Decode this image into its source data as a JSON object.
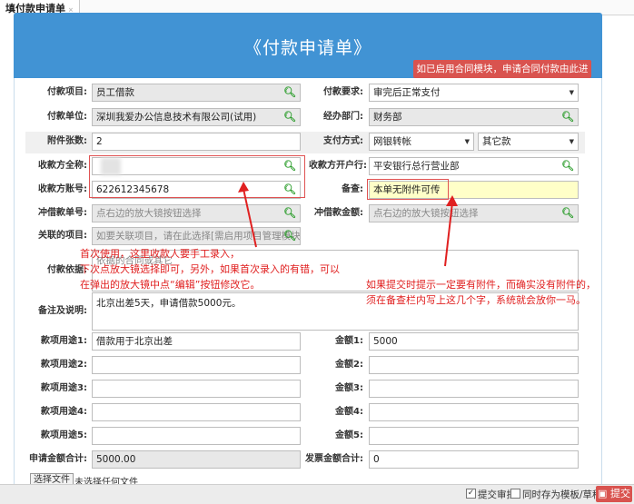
{
  "tab": {
    "label": "填付款申请单",
    "close": "×"
  },
  "form": {
    "title": "《付款申请单》",
    "contract_link": "如已启用合同模块，申请合同付款由此进>>",
    "pay_item": {
      "label": "付款项目:",
      "value": "员工借款"
    },
    "pay_req": {
      "label": "付款要求:",
      "value": "审完后正常支付"
    },
    "pay_unit": {
      "label": "付款单位:",
      "value": "深圳我爱办公信息技术有限公司(试用)"
    },
    "dept": {
      "label": "经办部门:",
      "value": "财务部"
    },
    "attach": {
      "label": "附件张数:",
      "value": "2"
    },
    "pay_method": {
      "label": "支付方式:",
      "value": "网银转帐",
      "value2": "其它款"
    },
    "payee_name": {
      "label": "收款方全称:",
      "value": ""
    },
    "payee_bank": {
      "label": "收款方开户行:",
      "value": "平安银行总行营业部"
    },
    "payee_acct": {
      "label": "收款方账号:",
      "value": "622612345678"
    },
    "remark": {
      "label": "备查:",
      "value": "本单无附件可传"
    },
    "offset_no": {
      "label": "冲借款单号:",
      "placeholder": "点右边的放大镜按钮选择"
    },
    "offset_amt": {
      "label": "冲借款金额:",
      "placeholder": "点右边的放大镜按钮选择"
    },
    "project": {
      "label": "关联的项目:",
      "placeholder": "如要关联项目，请在此选择[需启用项目管理模块]"
    },
    "basis": {
      "label": "付款依据:",
      "placeholder": "依据的合同或其它"
    },
    "desc": {
      "label": "备注及说明:",
      "value": "北京出差5天，申请借款5000元。"
    },
    "uses": [
      {
        "label": "款项用途1:",
        "value": "借款用于北京出差",
        "amt_label": "金额1:",
        "amt": "5000"
      },
      {
        "label": "款项用途2:",
        "value": "",
        "amt_label": "金额2:",
        "amt": ""
      },
      {
        "label": "款项用途3:",
        "value": "",
        "amt_label": "金额3:",
        "amt": ""
      },
      {
        "label": "款项用途4:",
        "value": "",
        "amt_label": "金额4:",
        "amt": ""
      },
      {
        "label": "款项用途5:",
        "value": "",
        "amt_label": "金额5:",
        "amt": ""
      }
    ],
    "total": {
      "label": "申请金额合计:",
      "value": "5000.00"
    },
    "invoice_total": {
      "label": "发票金额合计:",
      "value": "0"
    },
    "file": {
      "button": "选择文件",
      "status": "未选择任何文件"
    }
  },
  "notes": {
    "left": [
      "首次使用，这里收款人要手工录入，",
      "下次点放大镜选择即可，另外，如果首次录入的有错，可以",
      "在弹出的放大镜中点“编辑”按钮修改它。"
    ],
    "right": [
      "如果提交时提示一定要有附件，而确实没有附件的，",
      "须在备查栏内写上这几个字，系统就会放你一马。"
    ]
  },
  "footer": {
    "submit_review": "提交审批",
    "save_template": "同时存为模板/草稿",
    "submit": "提交",
    "submit_checked": true,
    "save_checked": false
  },
  "colors": {
    "header": "#4193d4",
    "red": "#d9534f",
    "note": "#e02020",
    "search_icon": "#2e9e2e"
  }
}
